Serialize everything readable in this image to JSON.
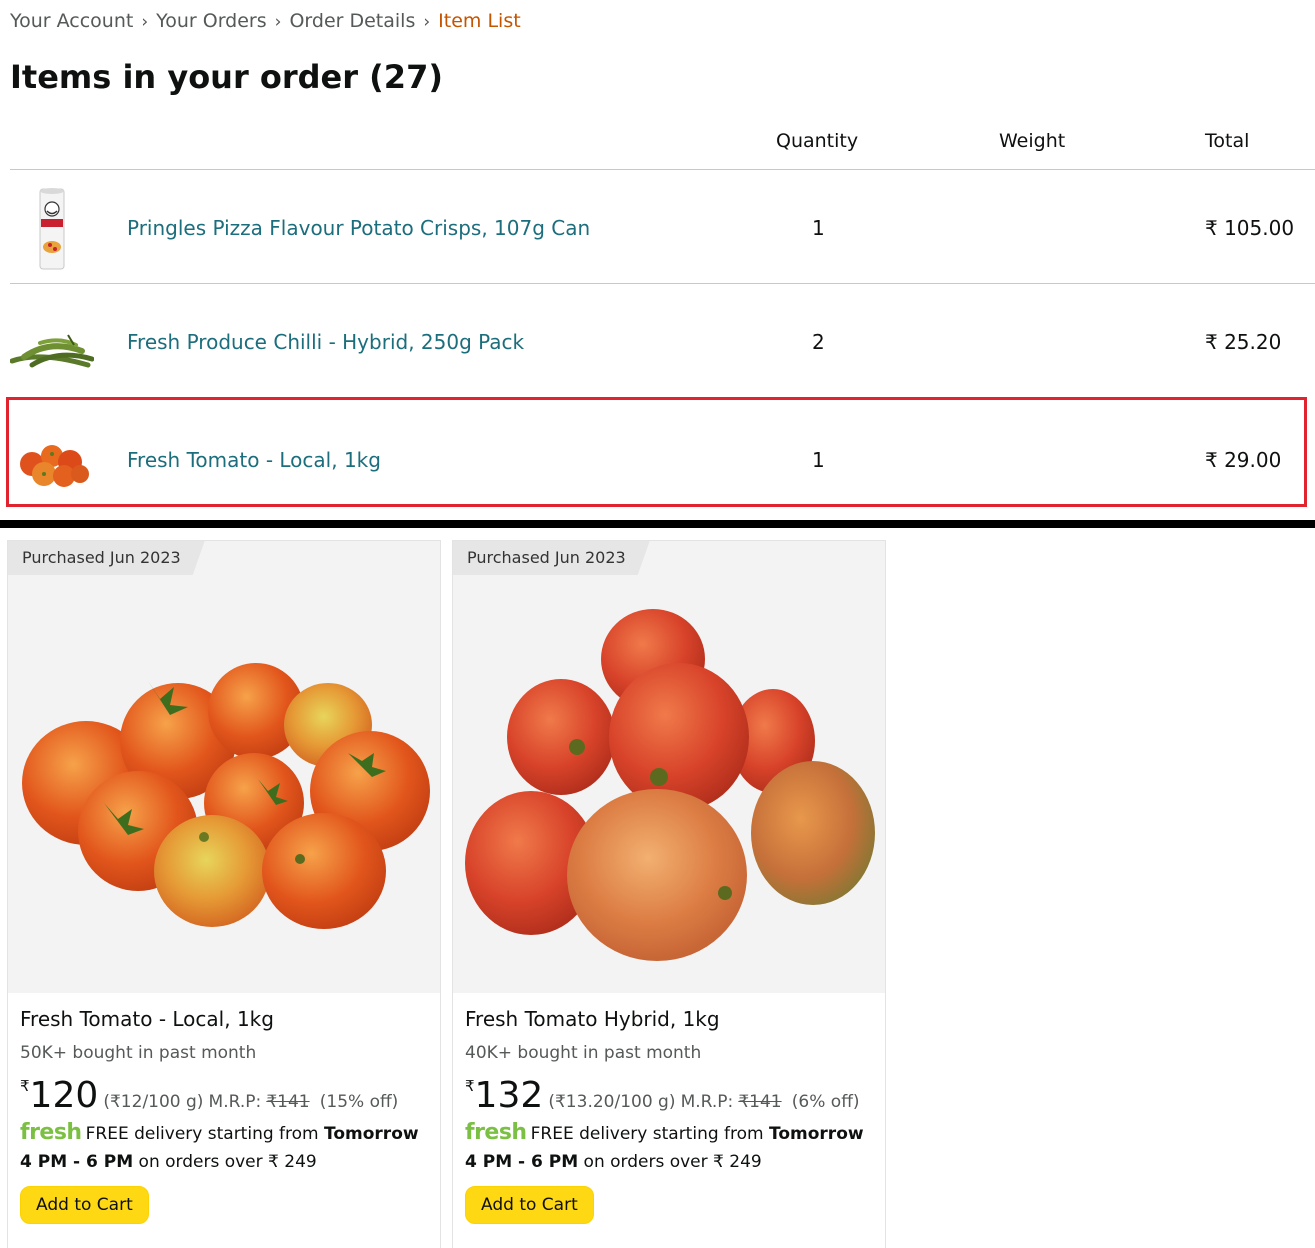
{
  "breadcrumb": {
    "items": [
      "Your Account",
      "Your Orders",
      "Order Details"
    ],
    "current": "Item List",
    "separator": "›"
  },
  "page_title": "Items in your order (27)",
  "table": {
    "headers": {
      "quantity": "Quantity",
      "weight": "Weight",
      "total": "Total"
    },
    "rows": [
      {
        "name": "Pringles Pizza Flavour Potato Crisps, 107g Can",
        "quantity": "1",
        "weight": "",
        "total": "₹ 105.00",
        "thumb_icon": "pringles-can-icon"
      },
      {
        "name": "Fresh Produce Chilli - Hybrid, 250g Pack",
        "quantity": "2",
        "weight": "",
        "total": "₹ 25.20",
        "thumb_icon": "green-chilli-icon"
      },
      {
        "name": "Fresh Tomato - Local, 1kg",
        "quantity": "1",
        "weight": "",
        "total": "₹ 29.00",
        "thumb_icon": "tomato-icon",
        "highlighted": true
      }
    ]
  },
  "products": [
    {
      "badge": "Purchased Jun 2023",
      "title": "Fresh Tomato - Local, 1kg",
      "bought": "50K+ bought in past month",
      "price_symbol": "₹",
      "price": "120",
      "unit_price": "(₹12/100 g)",
      "mrp_label": "M.R.P:",
      "mrp": "₹141",
      "discount": "(15% off)",
      "fresh_logo": "fresh",
      "delivery_text": "FREE delivery starting from",
      "delivery_time": "Tomorrow 4 PM - 6 PM",
      "delivery_suffix": "on orders over ₹ 249",
      "button": "Add to Cart"
    },
    {
      "badge": "Purchased Jun 2023",
      "title": "Fresh Tomato Hybrid, 1kg",
      "bought": "40K+ bought in past month",
      "price_symbol": "₹",
      "price": "132",
      "unit_price": "(₹13.20/100 g)",
      "mrp_label": "M.R.P:",
      "mrp": "₹141",
      "discount": "(6% off)",
      "fresh_logo": "fresh",
      "delivery_text": "FREE delivery starting from",
      "delivery_time": "Tomorrow 4 PM - 6 PM",
      "delivery_suffix": "on orders over ₹ 249",
      "button": "Add to Cart"
    }
  ],
  "colors": {
    "link": "#1c6e7d",
    "breadcrumb_current": "#c45500",
    "highlight_border": "#e0232e",
    "button": "#ffd814",
    "fresh_logo": "#7cc043"
  }
}
